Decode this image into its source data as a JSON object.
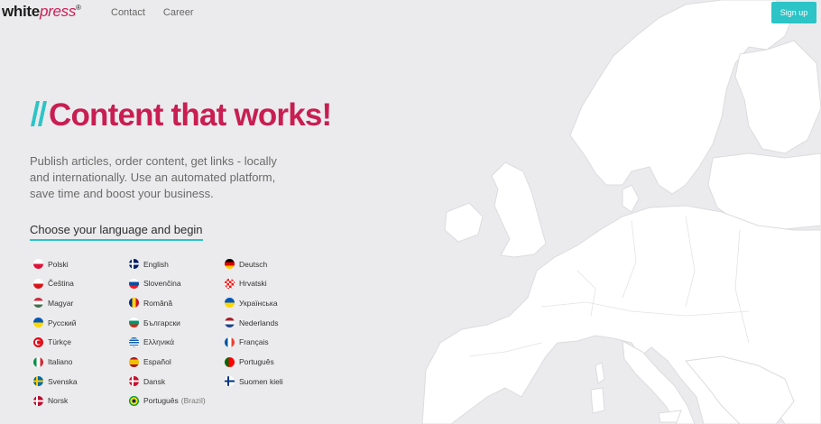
{
  "header": {
    "logo_white": "white",
    "logo_press": "press",
    "logo_reg": "®",
    "nav": [
      "Contact",
      "Career"
    ],
    "signup_label": "Sign up"
  },
  "hero": {
    "title": "Content that works!",
    "description": "Publish articles, order content, get links - locally and internationally. Use an automated platform, save time and boost your business.",
    "choose_label": "Choose your language and begin"
  },
  "colors": {
    "brand": "#c81e52",
    "accent": "#2cc4c6",
    "background": "#ebebed",
    "map_land": "#ffffff"
  },
  "languages": [
    [
      {
        "label": "Polski",
        "flag": "pl-flag-icon"
      },
      {
        "label": "Čeština",
        "flag": "cz-flag-icon"
      },
      {
        "label": "Magyar",
        "flag": "hu-flag-icon"
      },
      {
        "label": "Русский",
        "flag": "ua-flag-icon"
      },
      {
        "label": "Türkçe",
        "flag": "tr-flag-icon"
      },
      {
        "label": "Italiano",
        "flag": "it-flag-icon"
      },
      {
        "label": "Svenska",
        "flag": "se-flag-icon"
      },
      {
        "label": "Norsk",
        "flag": "no-flag-icon"
      }
    ],
    [
      {
        "label": "English",
        "flag": "gb-flag-icon"
      },
      {
        "label": "Slovenčina",
        "flag": "sk-flag-icon"
      },
      {
        "label": "Română",
        "flag": "ro-flag-icon"
      },
      {
        "label": "Български",
        "flag": "bg-flag-icon"
      },
      {
        "label": "Ελληνικά",
        "flag": "gr-flag-icon"
      },
      {
        "label": "Español",
        "flag": "es-flag-icon"
      },
      {
        "label": "Dansk",
        "flag": "dk-flag-icon"
      },
      {
        "label": "Português",
        "note": "(Brazil)",
        "flag": "br-flag-icon"
      }
    ],
    [
      {
        "label": "Deutsch",
        "flag": "de-flag-icon"
      },
      {
        "label": "Hrvatski",
        "flag": "hr-flag-icon"
      },
      {
        "label": "Українська",
        "flag": "ua-flag-icon"
      },
      {
        "label": "Nederlands",
        "flag": "nl-flag-icon"
      },
      {
        "label": "Français",
        "flag": "fr-flag-icon"
      },
      {
        "label": "Português",
        "flag": "pt-flag-icon"
      },
      {
        "label": "Suomen kieli",
        "flag": "fi-flag-icon"
      }
    ]
  ]
}
